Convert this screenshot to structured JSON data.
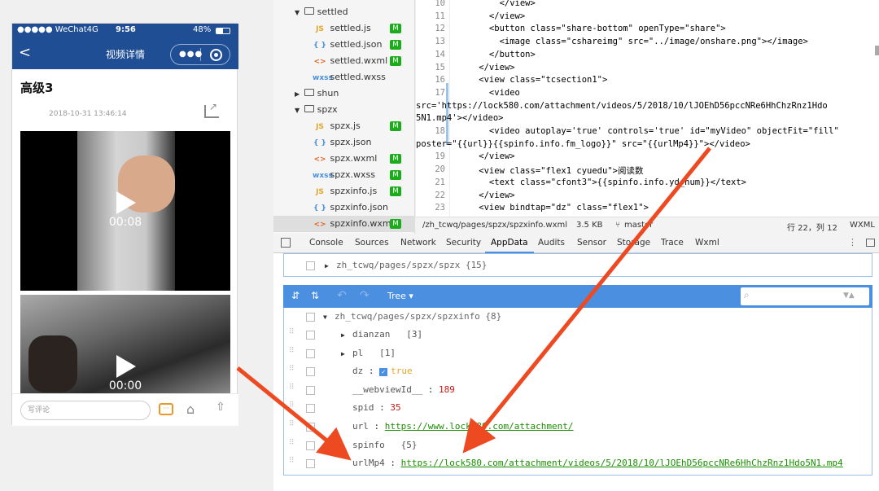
{
  "simulator": {
    "carrier": "●●●●● WeChat4G",
    "time": "9:56",
    "battery": "48%",
    "nav_title": "视频详情",
    "back_label": "<",
    "article_title": "高级3",
    "date": "2018-10-31 13:46:14",
    "video1_time": "00:08",
    "video2_time": "00:00",
    "comment_placeholder": "写评论"
  },
  "file_tree": {
    "items": [
      {
        "label": "settled",
        "type": "folder",
        "expanded": true
      },
      {
        "label": "settled.js",
        "type": "js",
        "badge": "M"
      },
      {
        "label": "settled.json",
        "type": "json",
        "badge": "M"
      },
      {
        "label": "settled.wxml",
        "type": "wxml",
        "badge": "M"
      },
      {
        "label": "settled.wxss",
        "type": "wxss",
        "badge": ""
      },
      {
        "label": "shun",
        "type": "folder",
        "expanded": false
      },
      {
        "label": "spzx",
        "type": "folder",
        "expanded": true
      },
      {
        "label": "spzx.js",
        "type": "js",
        "badge": "M"
      },
      {
        "label": "spzx.json",
        "type": "json",
        "badge": ""
      },
      {
        "label": "spzx.wxml",
        "type": "wxml",
        "badge": "M"
      },
      {
        "label": "spzx.wxss",
        "type": "wxss",
        "badge": "M"
      },
      {
        "label": "spzxinfo.js",
        "type": "js",
        "badge": "M"
      },
      {
        "label": "spzxinfo.json",
        "type": "json",
        "badge": ""
      },
      {
        "label": "spzxinfo.wxml",
        "type": "wxml",
        "badge": "M"
      }
    ]
  },
  "editor": {
    "line_numbers": [
      "10",
      "11",
      "12",
      "13",
      "14",
      "15",
      "16",
      "17",
      "",
      "",
      "18",
      "",
      "19",
      "20",
      "21",
      "22",
      "23"
    ],
    "lines": [
      "        </view>",
      "      </view>",
      "      <button class=\"share-bottom\" openType=\"share\">",
      "        <image class=\"cshareimg\" src=\"../image/onshare.png\"></image>",
      "      </button>",
      "    </view>",
      "    <view class=\"tcsection1\">",
      "      <video",
      "src='https://lock580.com/attachment/videos/5/2018/10/lJOEhD56pccNRe6HhChzRnz1Hdo",
      "5N1.mp4'></video>",
      "      <video autoplay='true' controls='true' id=\"myVideo\" objectFit=\"fill\"",
      "poster=\"{{url}}{{spinfo.info.fm_logo}}\" src=\"{{urlMp4}}\"></video>",
      "    </view>",
      "    <view class=\"flex1 cyuedu\">阅读数",
      "      <text class=\"cfont3\">{{spinfo.info.yd_num}}</text>",
      "    </view>",
      "    <view bindtap=\"dz\" class=\"flex1\">"
    ],
    "file_path": "/zh_tcwq/pages/spzx/spzxinfo.wxml",
    "file_size": "3.5 KB",
    "branch": "master",
    "cursor": "行 22，列 12",
    "lang": "WXML"
  },
  "devtools": {
    "tabs": [
      "Console",
      "Sources",
      "Network",
      "Security",
      "AppData",
      "Audits",
      "Sensor",
      "Storage",
      "Trace",
      "Wxml"
    ],
    "active_tab": "AppData",
    "collapsed_page": "zh_tcwq/pages/spzx/spzx {15}",
    "tree_mode": "Tree",
    "page_node": "zh_tcwq/pages/spzx/spzxinfo {8}",
    "rows": [
      {
        "key": "dianzan",
        "value": "[3]",
        "expandable": true,
        "kind": "meta"
      },
      {
        "key": "pl",
        "value": "[1]",
        "expandable": true,
        "kind": "meta"
      },
      {
        "key": "dz",
        "value": "true",
        "expandable": false,
        "kind": "bool"
      },
      {
        "key": "__webviewId__",
        "value": "189",
        "expandable": false,
        "kind": "num"
      },
      {
        "key": "spid",
        "value": "35",
        "expandable": false,
        "kind": "num"
      },
      {
        "key": "url",
        "value": "https://www.lock580.com/attachment/",
        "expandable": false,
        "kind": "link"
      },
      {
        "key": "spinfo",
        "value": "{5}",
        "expandable": true,
        "kind": "meta"
      },
      {
        "key": "urlMp4",
        "value": "https://lock580.com/attachment/videos/5/2018/10/lJOEhD56pccNRe6HhChzRnz1Hdo5N1.mp4",
        "expandable": false,
        "kind": "link"
      }
    ]
  },
  "colors": {
    "accent": "#1f4e95",
    "arrow": "#ee4a22",
    "badge": "#1aad19",
    "devtools_bar": "#4a8fe0"
  }
}
